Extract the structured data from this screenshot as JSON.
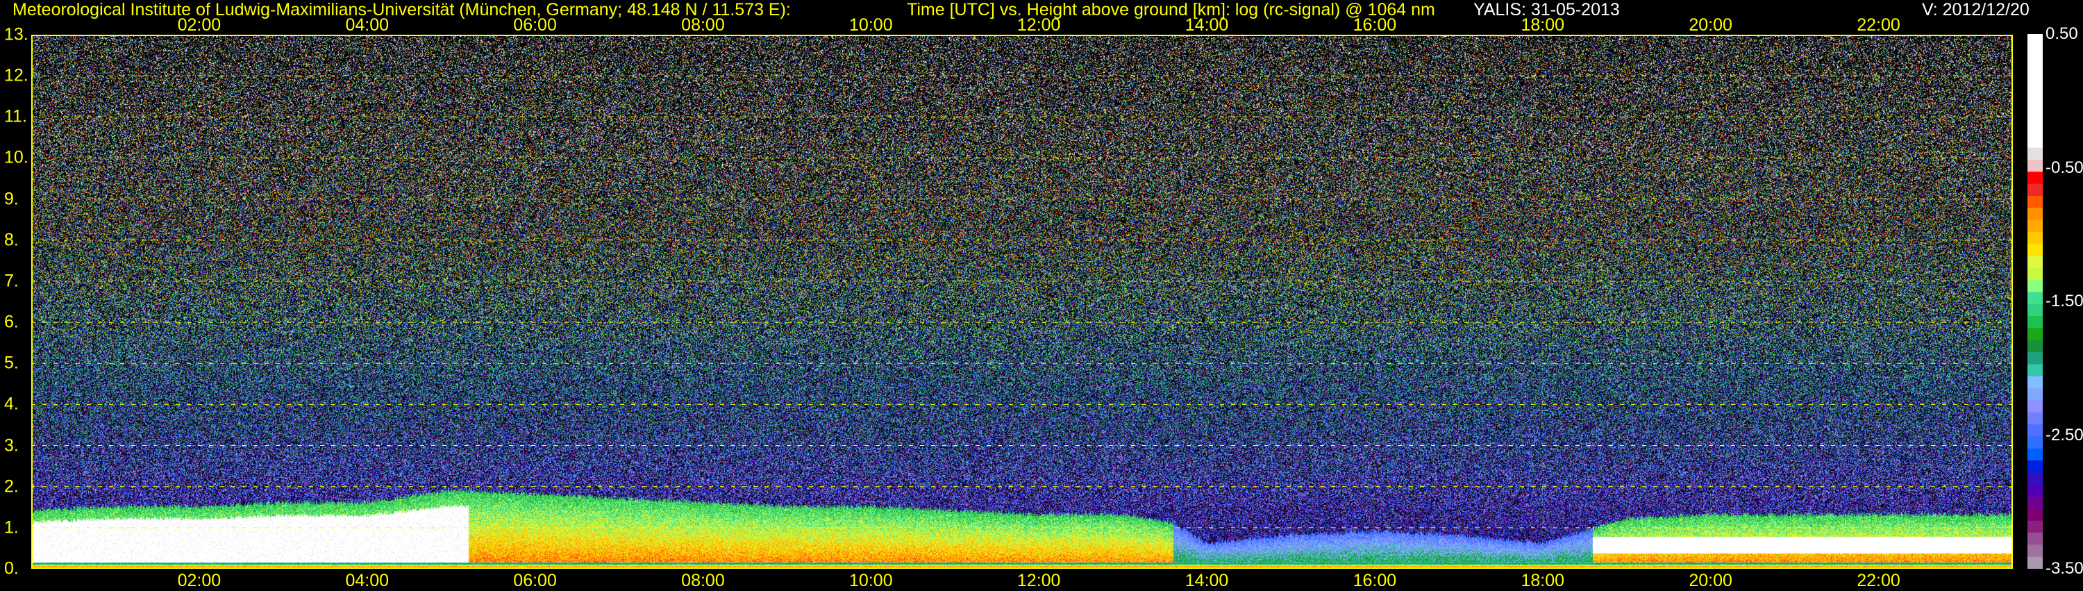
{
  "header": {
    "institute": "Meteorological Institute of Ludwig-Maximilians-Universität (München, Germany; 48.148 N / 11.573 E):",
    "description": "Time [UTC] vs. Height above ground [km]: log (rc-signal) @ 1064 nm",
    "site_date": "YALIS: 31-05-2013",
    "version": "V: 2012/12/20"
  },
  "chart_data": {
    "type": "heatmap",
    "title": "Time [UTC] vs. Height above ground [km]: log (rc-signal) @ 1064 nm",
    "xlabel": "Time [UTC]",
    "ylabel": "Height above ground [km]",
    "x_range_hours": [
      0.0,
      23.6
    ],
    "ylim": [
      0,
      13
    ],
    "x_ticks": [
      "02:00",
      "04:00",
      "06:00",
      "08:00",
      "10:00",
      "12:00",
      "14:00",
      "16:00",
      "18:00",
      "20:00",
      "22:00"
    ],
    "x_tick_hours": [
      2,
      4,
      6,
      8,
      10,
      12,
      14,
      16,
      18,
      20,
      22
    ],
    "y_ticks": [
      "0.",
      "1.",
      "2.",
      "3.",
      "4.",
      "5.",
      "6.",
      "7.",
      "8.",
      "9.",
      "10.",
      "11.",
      "12.",
      "13."
    ],
    "grid": true,
    "colorbar": {
      "range": [
        -3.5,
        0.5
      ],
      "tick_labels": [
        "0.50",
        "-0.50",
        "-1.50",
        "-2.50",
        "-3.50"
      ],
      "tick_values": [
        0.5,
        -0.5,
        -1.5,
        -2.5,
        -3.5
      ],
      "colors": [
        "#ffffff",
        "#e8e0e0",
        "#ecc4c4",
        "#ff0000",
        "#f02828",
        "#ff5a00",
        "#ff9000",
        "#ffaa00",
        "#ffc800",
        "#ffe400",
        "#e0f840",
        "#c8f840",
        "#88ff80",
        "#40e090",
        "#30d080",
        "#20c050",
        "#18a818",
        "#189038",
        "#20a080",
        "#30c8a8",
        "#80c0ff",
        "#80a8ff",
        "#9090ff",
        "#7080ff",
        "#5070ff",
        "#3070ff",
        "#0060ff",
        "#0020e0",
        "#3010c0",
        "#5000b0",
        "#700090",
        "#800070",
        "#8a2080",
        "#985090",
        "#a070a0",
        "#a898b0"
      ]
    },
    "aerosol_layer_top_km": {
      "hours": [
        0,
        1,
        2,
        3,
        4,
        5,
        6,
        7,
        8,
        9,
        10,
        11,
        12,
        13,
        13.6,
        14,
        15,
        16,
        17,
        18,
        19,
        20,
        21,
        22,
        23.6
      ],
      "values": [
        1.4,
        1.5,
        1.5,
        1.6,
        1.6,
        1.9,
        1.8,
        1.7,
        1.6,
        1.5,
        1.5,
        1.4,
        1.3,
        1.3,
        1.1,
        0.6,
        0.8,
        0.9,
        0.8,
        0.6,
        1.2,
        1.3,
        1.3,
        1.3,
        1.3
      ]
    }
  }
}
